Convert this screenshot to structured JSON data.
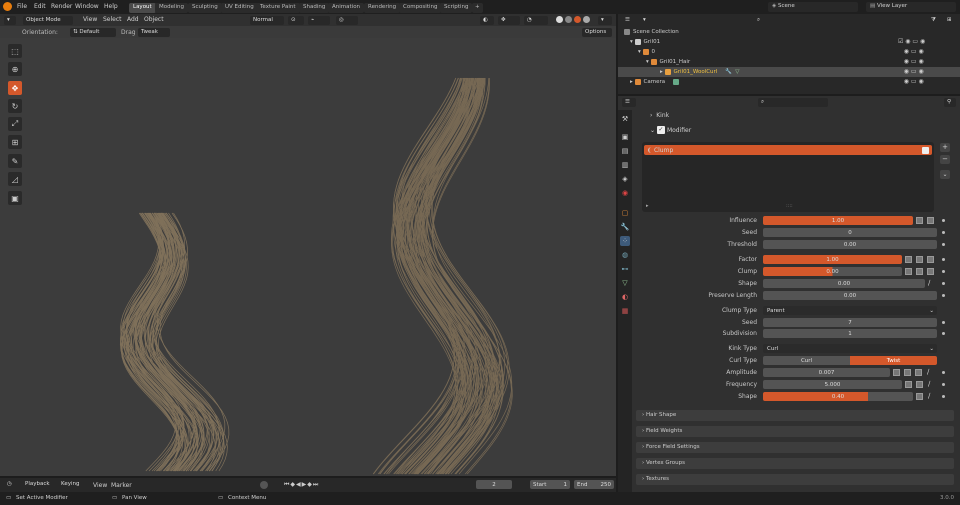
{
  "topbar": {
    "menus": [
      "File",
      "Edit",
      "Render",
      "Window",
      "Help"
    ],
    "workspaces": [
      "Layout",
      "Modeling",
      "Sculpting",
      "UV Editing",
      "Texture Paint",
      "Shading",
      "Animation",
      "Rendering",
      "Compositing",
      "Scripting"
    ],
    "active_workspace": "Layout",
    "scene": "Scene",
    "view_layer": "View Layer"
  },
  "viewport": {
    "mode": "Object Mode",
    "menus": [
      "View",
      "Select",
      "Add",
      "Object"
    ],
    "transform": "Normal",
    "orientation_label": "Orientation:",
    "orientation_value": "Default",
    "drag_label": "Drag",
    "drag_value": "Tweak",
    "options": "Options"
  },
  "outliner": {
    "rows": [
      "Scene Collection",
      "Gril01",
      "0",
      "Gril01_Hair",
      "Gril01_WoolCurl",
      "Camera"
    ]
  },
  "properties": {
    "kink": "Kink",
    "modifier": "Modifier",
    "modifier_item": "Clump",
    "influence_label": "Influence",
    "influence": "1.00",
    "seed_label": "Seed",
    "seed": "0",
    "threshold_label": "Threshold",
    "threshold": "0.00",
    "factor_label": "Factor",
    "factor": "1.00",
    "clump_label": "Clump",
    "clump": "0.00",
    "shape_label": "Shape",
    "shape": "0.00",
    "preserve_label": "Preserve Length",
    "preserve": "0.00",
    "clump_type_label": "Clump Type",
    "clump_type": "Parent",
    "seed2_label": "Seed",
    "seed2": "7",
    "subdivision_label": "Subdivision",
    "subdivision": "1",
    "kink_type_label": "Kink Type",
    "kink_type": "Curl",
    "curl_type_label": "Curl Type",
    "curl_opt1": "Curl",
    "curl_opt2": "Twist",
    "amplitude_label": "Amplitude",
    "amplitude": "0.007",
    "frequency_label": "Frequency",
    "frequency": "5.000",
    "shape2_label": "Shape",
    "shape2": "0.40",
    "panels": [
      "Hair Shape",
      "Field Weights",
      "Force Field Settings",
      "Vertex Groups",
      "Textures"
    ]
  },
  "timeline": {
    "menus": [
      "Playback",
      "Keying",
      "View",
      "Marker"
    ],
    "current_frame": "2",
    "start_label": "Start",
    "start": "1",
    "end_label": "End",
    "end": "250"
  },
  "statusbar": {
    "items": [
      "Set Active Modifier",
      "Pan View",
      "Context Menu"
    ],
    "version": "3.0.0"
  },
  "colors": {
    "accent": "#d4582b",
    "panel": "#303030",
    "field": "#545454"
  }
}
